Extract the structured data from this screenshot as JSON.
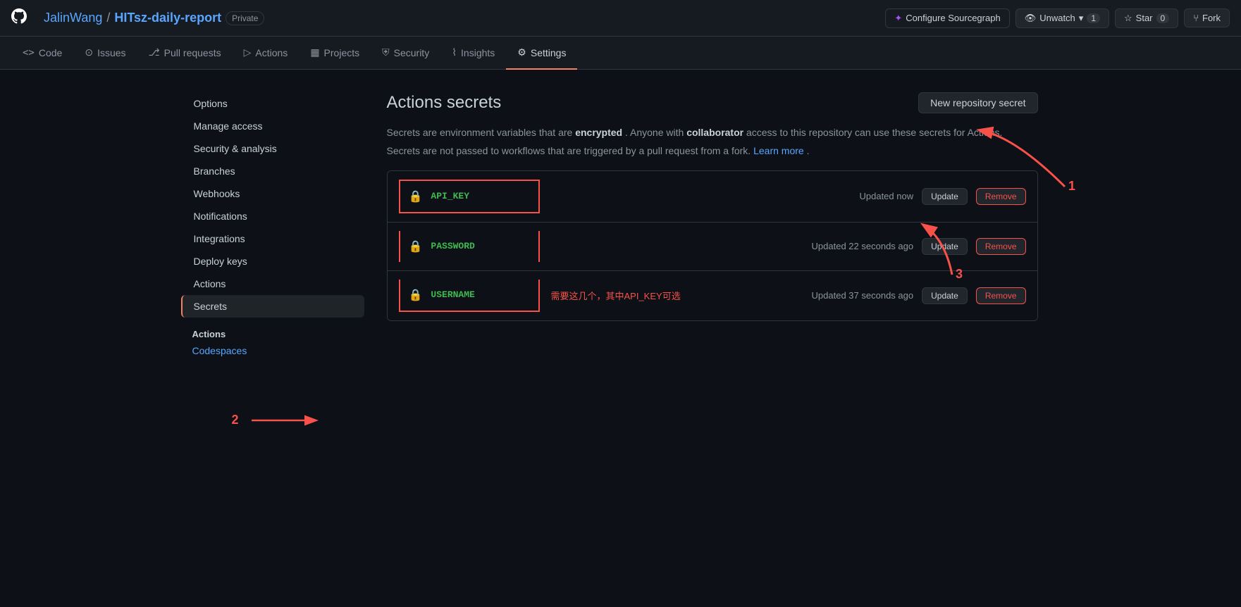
{
  "topbar": {
    "logo": "⬡",
    "owner": "JalinWang",
    "separator": "/",
    "repo_name": "HITsz-daily-report",
    "badge": "Private",
    "configure_sourcegraph": "Configure Sourcegraph",
    "unwatch": "Unwatch",
    "unwatch_count": "1",
    "star": "Star",
    "star_count": "0",
    "fork": "Fork"
  },
  "nav": {
    "tabs": [
      {
        "id": "code",
        "icon": "<>",
        "label": "Code"
      },
      {
        "id": "issues",
        "icon": "⊙",
        "label": "Issues"
      },
      {
        "id": "pull-requests",
        "icon": "⎇",
        "label": "Pull requests"
      },
      {
        "id": "actions",
        "icon": "▷",
        "label": "Actions"
      },
      {
        "id": "projects",
        "icon": "▦",
        "label": "Projects"
      },
      {
        "id": "security",
        "icon": "⛨",
        "label": "Security"
      },
      {
        "id": "insights",
        "icon": "⌇",
        "label": "Insights"
      },
      {
        "id": "settings",
        "icon": "⚙",
        "label": "Settings",
        "active": true
      }
    ]
  },
  "sidebar": {
    "items": [
      {
        "id": "options",
        "label": "Options",
        "active": false
      },
      {
        "id": "manage-access",
        "label": "Manage access",
        "active": false
      },
      {
        "id": "security-analysis",
        "label": "Security & analysis",
        "active": false
      },
      {
        "id": "branches",
        "label": "Branches",
        "active": false
      },
      {
        "id": "webhooks",
        "label": "Webhooks",
        "active": false
      },
      {
        "id": "notifications",
        "label": "Notifications",
        "active": false
      },
      {
        "id": "integrations",
        "label": "Integrations",
        "active": false
      },
      {
        "id": "deploy-keys",
        "label": "Deploy keys",
        "active": false
      },
      {
        "id": "actions-item",
        "label": "Actions",
        "active": false
      },
      {
        "id": "secrets",
        "label": "Secrets",
        "active": true
      }
    ],
    "actions_section_label": "Actions",
    "codespaces_link": "Codespaces"
  },
  "main": {
    "title": "Actions secrets",
    "new_secret_button": "New repository secret",
    "description_line1_pre": "Secrets are environment variables that are ",
    "description_line1_bold1": "encrypted",
    "description_line1_mid": ". Anyone with ",
    "description_line1_bold2": "collaborator",
    "description_line1_post": " access to this repository can use these secrets for Actions.",
    "description_line2_pre": "Secrets are not passed to workflows that are triggered by a pull request from a fork. ",
    "description_line2_link": "Learn more",
    "description_line2_post": ".",
    "secrets": [
      {
        "name": "API_KEY",
        "updated": "Updated now",
        "annotation": "",
        "update_btn": "Update",
        "remove_btn": "Remove"
      },
      {
        "name": "PASSWORD",
        "updated": "Updated 22 seconds ago",
        "annotation": "",
        "update_btn": "Update",
        "remove_btn": "Remove"
      },
      {
        "name": "USERNAME",
        "updated": "Updated 37 seconds ago",
        "annotation": "需要这几个，其中API_KEY可选",
        "update_btn": "Update",
        "remove_btn": "Remove"
      }
    ],
    "annotation_numbers": {
      "n1": "1",
      "n2": "2",
      "n3": "3"
    }
  }
}
